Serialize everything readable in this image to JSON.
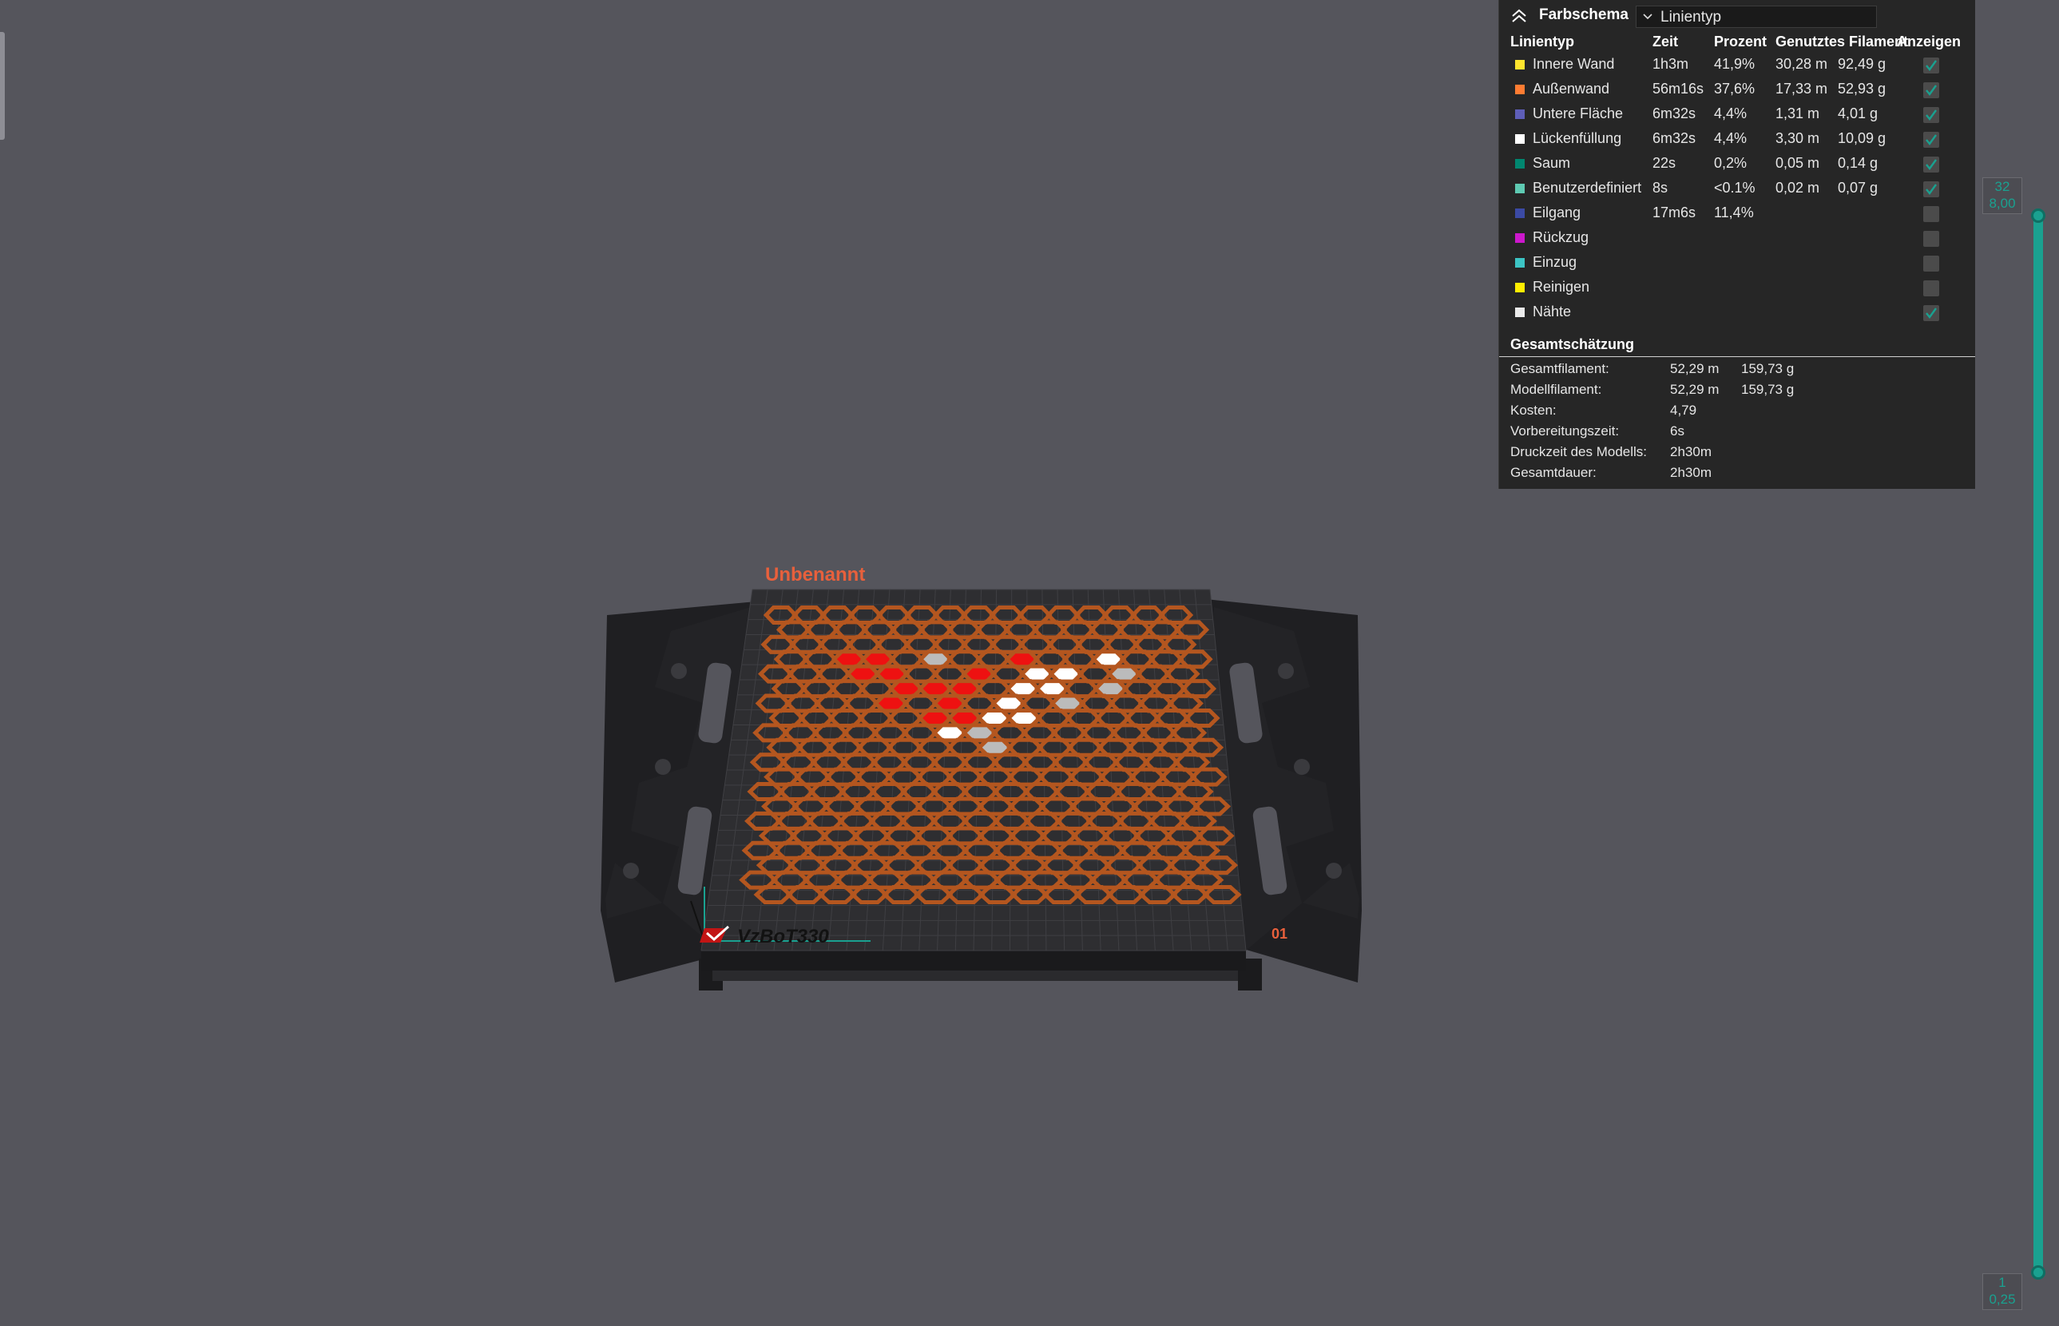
{
  "legend": {
    "scheme_label": "Farbschema",
    "scheme_value": "Linientyp",
    "columns": {
      "type": "Linientyp",
      "time": "Zeit",
      "percent": "Prozent",
      "filament": "Genutztes Filament",
      "show": "Anzeigen"
    },
    "rows": [
      {
        "name": "Innere Wand",
        "color": "#ffe52e",
        "time": "1h3m",
        "percent": "41,9%",
        "length": "30,28 m",
        "weight": "92,49 g",
        "shown": true
      },
      {
        "name": "Außenwand",
        "color": "#ff7c32",
        "time": "56m16s",
        "percent": "37,6%",
        "length": "17,33 m",
        "weight": "52,93 g",
        "shown": true
      },
      {
        "name": "Untere Fläche",
        "color": "#5e5eb8",
        "time": "6m32s",
        "percent": "4,4%",
        "length": "1,31 m",
        "weight": "4,01 g",
        "shown": true
      },
      {
        "name": "Lückenfüllung",
        "color": "#ffffff",
        "time": "6m32s",
        "percent": "4,4%",
        "length": "3,30 m",
        "weight": "10,09 g",
        "shown": true
      },
      {
        "name": "Saum",
        "color": "#00866f",
        "time": "22s",
        "percent": "0,2%",
        "length": "0,05 m",
        "weight": "0,14 g",
        "shown": true
      },
      {
        "name": "Benutzerdefiniert",
        "color": "#5ecab2",
        "time": "8s",
        "percent": "<0.1%",
        "length": "0,02 m",
        "weight": "0,07 g",
        "shown": true
      },
      {
        "name": "Eilgang",
        "color": "#3b4aa4",
        "time": "17m6s",
        "percent": "11,4%",
        "length": "",
        "weight": "",
        "shown": false
      },
      {
        "name": "Rückzug",
        "color": "#cc18cc",
        "time": "",
        "percent": "",
        "length": "",
        "weight": "",
        "shown": false
      },
      {
        "name": "Einzug",
        "color": "#3cc4c4",
        "time": "",
        "percent": "",
        "length": "",
        "weight": "",
        "shown": false
      },
      {
        "name": "Reinigen",
        "color": "#ffee00",
        "time": "",
        "percent": "",
        "length": "",
        "weight": "",
        "shown": false
      },
      {
        "name": "Nähte",
        "color": "#ebebeb",
        "time": "",
        "percent": "",
        "length": "",
        "weight": "",
        "shown": true
      }
    ],
    "totals_title": "Gesamtschätzung",
    "totals": [
      {
        "label": "Gesamtfilament:",
        "value1": "52,29 m",
        "value2": "159,73 g"
      },
      {
        "label": "Modellfilament:",
        "value1": "52,29 m",
        "value2": "159,73 g"
      },
      {
        "label": "Kosten:",
        "value1": "4,79",
        "value2": ""
      },
      {
        "label": "Vorbereitungszeit:",
        "value1": "6s",
        "value2": ""
      },
      {
        "label": "Druckzeit des Modells:",
        "value1": "2h30m",
        "value2": ""
      },
      {
        "label": "Gesamtdauer:",
        "value1": "2h30m",
        "value2": ""
      }
    ]
  },
  "viewport": {
    "plate_name": "Unbenannt",
    "printer_logo": "VzBoT330",
    "plate_number": "01"
  },
  "layer_slider": {
    "top_layer": "32",
    "top_height": "8,00",
    "bottom_layer": "1",
    "bottom_height": "0,25"
  }
}
